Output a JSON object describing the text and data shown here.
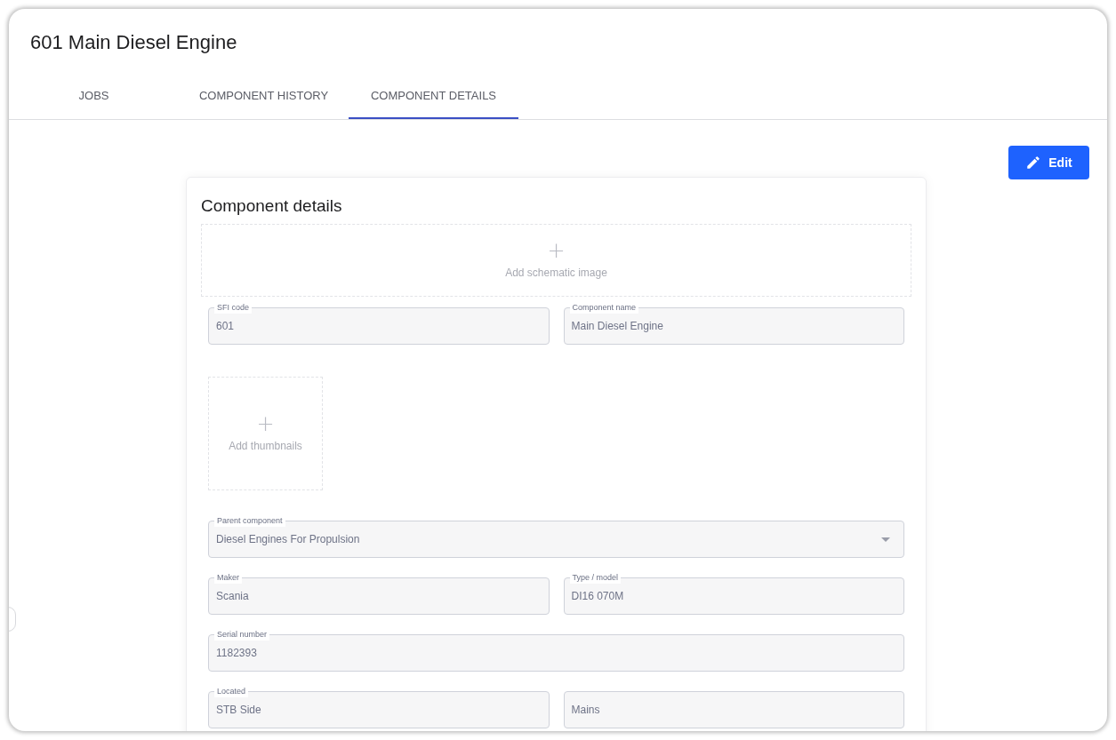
{
  "title": "601 Main Diesel Engine",
  "tabs": [
    {
      "label": "JOBS",
      "selected": false
    },
    {
      "label": "COMPONENT HISTORY",
      "selected": false
    },
    {
      "label": "COMPONENT DETAILS",
      "selected": true
    }
  ],
  "edit_button": "Edit",
  "card": {
    "title": "Component details",
    "schematic": {
      "icon": "+",
      "label": "Add schematic image"
    },
    "thumbnails": {
      "icon": "+",
      "label": "Add thumbnails"
    },
    "rows": [
      [
        {
          "kind": "text",
          "label": "SFI code",
          "value": "601"
        },
        {
          "kind": "text",
          "label": "Component name",
          "value": "Main Diesel Engine"
        }
      ],
      [
        {
          "kind": "thumbnails"
        }
      ],
      [
        {
          "kind": "select",
          "label": "Parent component",
          "value": "Diesel Engines For Propulsion"
        }
      ],
      [
        {
          "kind": "text",
          "label": "Maker",
          "value": "Scania"
        },
        {
          "kind": "text",
          "label": "Type / model",
          "value": "DI16 070M"
        }
      ],
      [
        {
          "kind": "text",
          "label": "Serial number",
          "value": "1182393"
        }
      ],
      [
        {
          "kind": "text",
          "label": "Located",
          "value": "STB Side"
        },
        {
          "kind": "textarea",
          "value": "Mains"
        }
      ]
    ]
  }
}
